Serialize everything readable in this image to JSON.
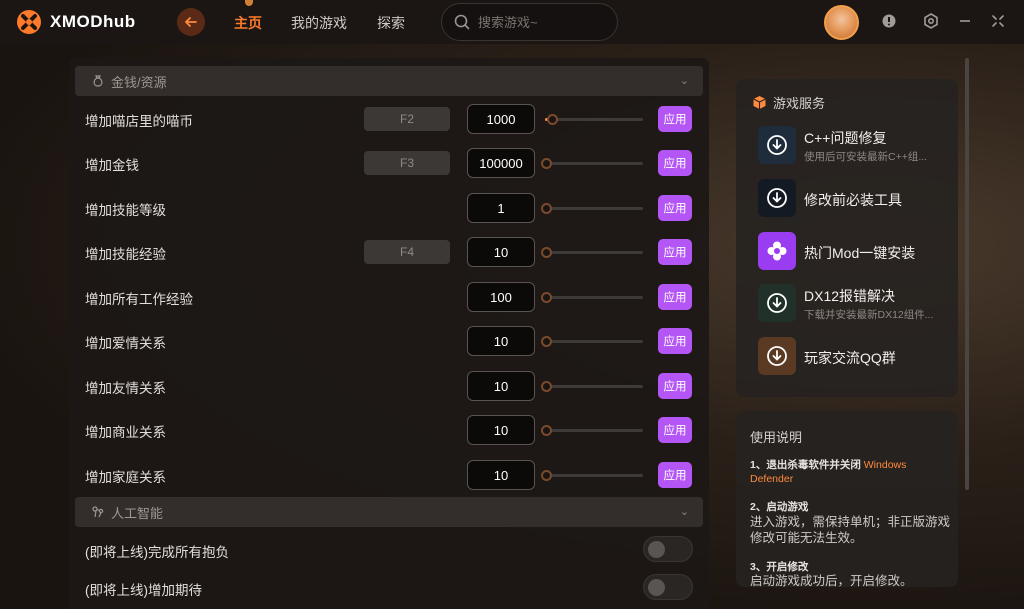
{
  "app": {
    "logo_text": "XMODhub"
  },
  "nav": {
    "items": [
      "主页",
      "我的游戏",
      "探索"
    ],
    "active_index": 0
  },
  "search": {
    "placeholder": "搜索游戏~"
  },
  "sections": {
    "money": {
      "title": "金钱/资源"
    },
    "ai": {
      "title": "人工智能"
    }
  },
  "cheats": [
    {
      "label": "增加喵店里的喵币",
      "hotkey": "F2",
      "value": "1000",
      "level": 0.06,
      "apply": "应用"
    },
    {
      "label": "增加金钱",
      "hotkey": "F3",
      "value": "100000",
      "level": 0.0,
      "apply": "应用"
    },
    {
      "label": "增加技能等级",
      "hotkey": "",
      "value": "1",
      "level": 0.0,
      "apply": "应用"
    },
    {
      "label": "增加技能经验",
      "hotkey": "F4",
      "value": "10",
      "level": 0.0,
      "apply": "应用"
    },
    {
      "label": "增加所有工作经验",
      "hotkey": "",
      "value": "100",
      "level": 0.0,
      "apply": "应用"
    },
    {
      "label": "增加爱情关系",
      "hotkey": "",
      "value": "10",
      "level": 0.0,
      "apply": "应用"
    },
    {
      "label": "增加友情关系",
      "hotkey": "",
      "value": "10",
      "level": 0.0,
      "apply": "应用"
    },
    {
      "label": "增加商业关系",
      "hotkey": "",
      "value": "10",
      "level": 0.0,
      "apply": "应用"
    },
    {
      "label": "增加家庭关系",
      "hotkey": "",
      "value": "10",
      "level": 0.0,
      "apply": "应用"
    }
  ],
  "ai_toggles": [
    {
      "label": "(即将上线)完成所有抱负",
      "on": false
    },
    {
      "label": "(即将上线)增加期待",
      "on": false
    }
  ],
  "services": {
    "title": "游戏服务",
    "items": [
      {
        "name": "C++问题修复",
        "desc": "使用后可安装最新C++组...",
        "icon": "download-icon",
        "bg": "#1e2c3c"
      },
      {
        "name": "修改前必装工具",
        "desc": "",
        "icon": "download-icon",
        "bg": "#141a24"
      },
      {
        "name": "热门Mod一键安装",
        "desc": "",
        "icon": "flower-icon",
        "bg": "#9a3df0"
      },
      {
        "name": "DX12报错解决",
        "desc": "下载并安装最新DX12组件...",
        "icon": "download-icon",
        "bg": "#22302a"
      },
      {
        "name": "玩家交流QQ群",
        "desc": "",
        "icon": "download-icon",
        "bg": "#5a3a22"
      }
    ]
  },
  "usage": {
    "title": "使用说明",
    "steps": [
      {
        "head": "1、退出杀毒软件并关闭",
        "highlight": "Windows Defender",
        "body": ""
      },
      {
        "head": "2、启动游戏",
        "highlight": "",
        "body": "进入游戏，需保持单机；非正版游戏修改可能无法生效。"
      },
      {
        "head": "3、开启修改",
        "highlight": "",
        "body": "启动游戏成功后，开启修改。"
      }
    ]
  },
  "colors": {
    "accent": "#ff7a2a",
    "apply": "#b455f5",
    "highlight": "#ff8a3d"
  }
}
